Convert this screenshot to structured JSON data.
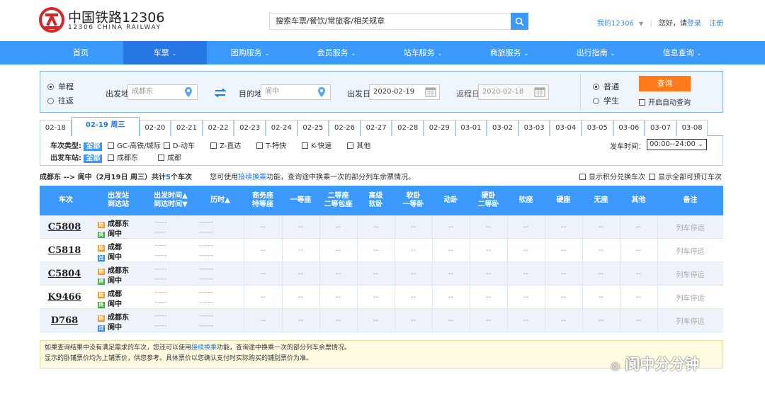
{
  "header": {
    "logo_cn": "中国铁路12306",
    "logo_en": "12306 CHINA RAILWAY",
    "search_placeholder": "搜索车票/餐饮/常旅客/相关规章",
    "my12306": "我的12306",
    "greeting": "您好，请",
    "login": "登录",
    "register": "注册"
  },
  "nav": [
    {
      "label": "首页",
      "caret": false,
      "active": false
    },
    {
      "label": "车票",
      "caret": true,
      "active": true
    },
    {
      "label": "团购服务",
      "caret": true,
      "active": false
    },
    {
      "label": "会员服务",
      "caret": true,
      "active": false
    },
    {
      "label": "站车服务",
      "caret": true,
      "active": false
    },
    {
      "label": "商旅服务",
      "caret": true,
      "active": false
    },
    {
      "label": "出行指南",
      "caret": true,
      "active": false
    },
    {
      "label": "信息查询",
      "caret": true,
      "active": false
    }
  ],
  "form": {
    "oneway": "单程",
    "roundtrip": "往返",
    "from_label": "出发地",
    "from_value": "成都东",
    "to_label": "目的地",
    "to_value": "阆中",
    "depart_label": "出发日",
    "depart_value": "2020-02-19",
    "return_label": "返程日",
    "return_value": "2020-02-18",
    "normal": "普通",
    "student": "学生",
    "query": "查询",
    "auto_query": "开启自动查询"
  },
  "dates": [
    "02-18",
    "02-19 周三",
    "02-20",
    "02-21",
    "02-22",
    "02-23",
    "02-24",
    "02-25",
    "02-26",
    "02-27",
    "02-28",
    "02-29",
    "03-01",
    "03-02",
    "03-03",
    "03-04",
    "03-05",
    "03-06",
    "03-07",
    "03-08"
  ],
  "filter": {
    "type_label": "车次类型:",
    "all": "全部",
    "types": [
      "GC-高铁/城际",
      "D-动车",
      "Z-直达",
      "T-特快",
      "K-快速",
      "其他"
    ],
    "station_label": "出发车站:",
    "stations": [
      "成都东",
      "成都"
    ],
    "time_label": "发车时间：",
    "time_value": "00:00--24:00"
  },
  "summary": {
    "route": "成都东 --> 阆中（2月19日  周三）共计",
    "count": "5",
    "count_suffix": "个车次",
    "tip_pre": "您可使用",
    "tip_link": "接续换乘",
    "tip_post": "功能，查询途中换乘一次的部分列车余票情况。",
    "opt1": "显示积分兑换车次",
    "opt2": "显示全部可预订车次"
  },
  "columns": [
    "车次",
    "出发站\n到达站",
    "出发时间▲\n到达时间▼",
    "历时▲",
    "商务座\n特等座",
    "一等座",
    "二等座\n二等包座",
    "高级\n软卧",
    "软卧\n一等卧",
    "动卧",
    "硬卧\n二等卧",
    "软座",
    "硬座",
    "无座",
    "其他",
    "备注"
  ],
  "trains": [
    {
      "no": "C5808",
      "from": "成都东",
      "from_icon": "始",
      "to": "阆中",
      "to_icon": "终",
      "to_kind": "e",
      "time1": "------",
      "time2": "------",
      "dur1": "-------",
      "dur2": "-------",
      "remark": "列车停运"
    },
    {
      "no": "C5818",
      "from": "成都",
      "from_icon": "始",
      "to": "阆中",
      "to_icon": "过",
      "to_kind": "p",
      "time1": "------",
      "time2": "------",
      "dur1": "-------",
      "dur2": "-------",
      "remark": "列车停运"
    },
    {
      "no": "C5804",
      "from": "成都东",
      "from_icon": "始",
      "to": "阆中",
      "to_icon": "终",
      "to_kind": "e",
      "time1": "------",
      "time2": "------",
      "dur1": "-------",
      "dur2": "-------",
      "remark": "列车停运"
    },
    {
      "no": "K9466",
      "from": "成都",
      "from_icon": "始",
      "to": "阆中",
      "to_icon": "终",
      "to_kind": "e",
      "time1": "------",
      "time2": "------",
      "dur1": "-------",
      "dur2": "-------",
      "remark": "列车停运"
    },
    {
      "no": "D768",
      "from": "成都东",
      "from_icon": "始",
      "to": "阆中",
      "to_icon": "过",
      "to_kind": "p",
      "time1": "------",
      "time2": "------",
      "dur1": "-------",
      "dur2": "-------",
      "remark": "列车停运"
    }
  ],
  "seat_placeholder": "--",
  "note": {
    "line1_pre": "如果查询结果中没有满足需求的车次，您还可以使用",
    "line1_link": "接续换乘",
    "line1_post": "功能，查询途中换乘一次的部分列车余票情况。",
    "line2": "显示的卧铺票价均为上铺票价，供您参考。具体票价以您确认支付时实际购买的铺别票价为准。"
  },
  "watermark": "阆中分分钟",
  "colors": {
    "brand_blue": "#3b99fc",
    "active_blue": "#2676e3",
    "query_orange": "#ff7a1a",
    "logo_red": "#d7262a"
  }
}
